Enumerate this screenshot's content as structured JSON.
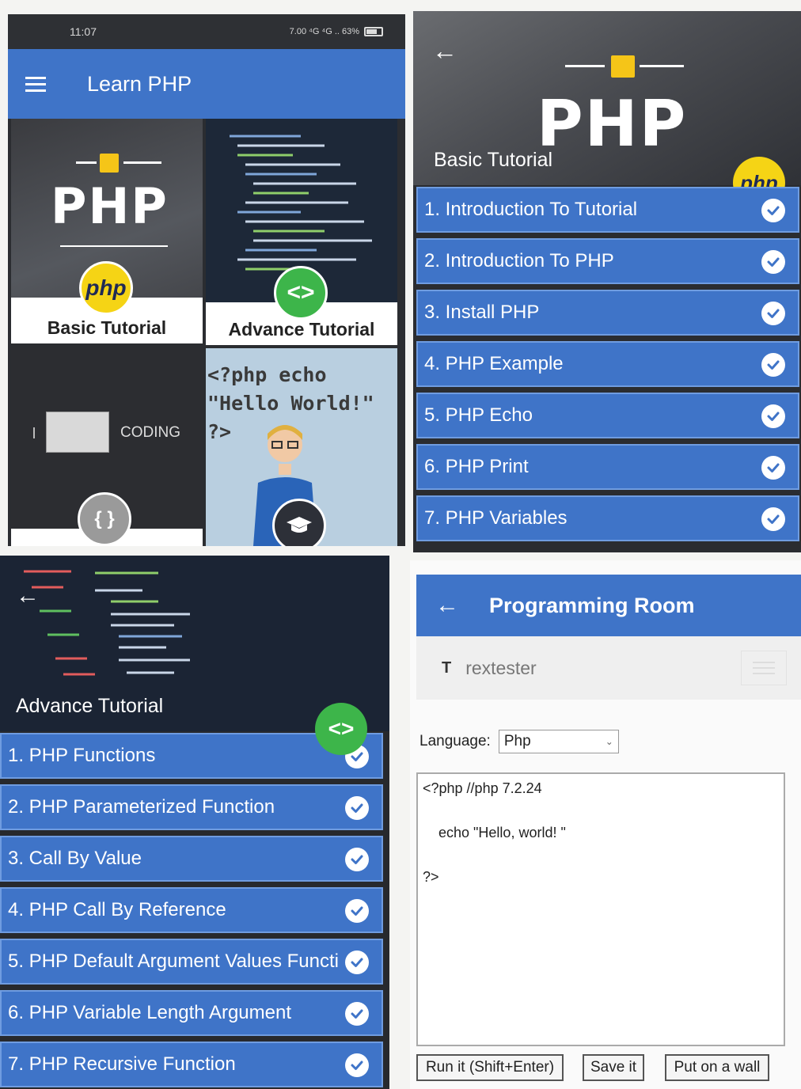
{
  "home": {
    "status_time": "11:07",
    "status_icons": "7.00  ⁴G  ⁴G  ..  63%",
    "app_title": "Learn PHP",
    "tiles": {
      "basic_logo": "PHP",
      "basic_badge": "php",
      "basic_label": "Basic Tutorial",
      "advance_badge": "<>",
      "advance_label": "Advance Tutorial",
      "coding_text": "CODING",
      "coding_badge": "{ }",
      "hello_code_1": "<?php echo",
      "hello_code_2": "\"Hello World!\"",
      "hello_code_3": "?>"
    }
  },
  "basic": {
    "logo": "PHP",
    "heading": "Basic Tutorial",
    "badge": "php",
    "items": [
      "1. Introduction To Tutorial",
      "2. Introduction To PHP",
      "3. Install PHP",
      "4. PHP Example",
      "5. PHP Echo",
      "6. PHP Print",
      "7. PHP Variables"
    ]
  },
  "advance": {
    "heading": "Advance Tutorial",
    "badge": "<>",
    "items": [
      "1. PHP Functions",
      "2. PHP Parameterized Function",
      "3. Call By Value",
      "4. PHP Call By Reference",
      "5. PHP Default Argument Values Functi",
      "6. PHP Variable Length Argument",
      "7. PHP Recursive Function"
    ]
  },
  "room": {
    "title": "Programming Room",
    "site_name": "rextester",
    "site_icon": "T",
    "language_label": "Language:",
    "language_value": "Php",
    "code_lines": [
      "<?php //php 7.2.24",
      "",
      "    echo \"Hello, world! \"",
      "",
      "?>"
    ],
    "buttons": [
      "Run it (Shift+Enter)",
      "Save it",
      "Put on a wall"
    ]
  },
  "colors": {
    "primary": "#3f74c8",
    "php_yellow": "#f5d415",
    "code_green": "#3db54a"
  }
}
